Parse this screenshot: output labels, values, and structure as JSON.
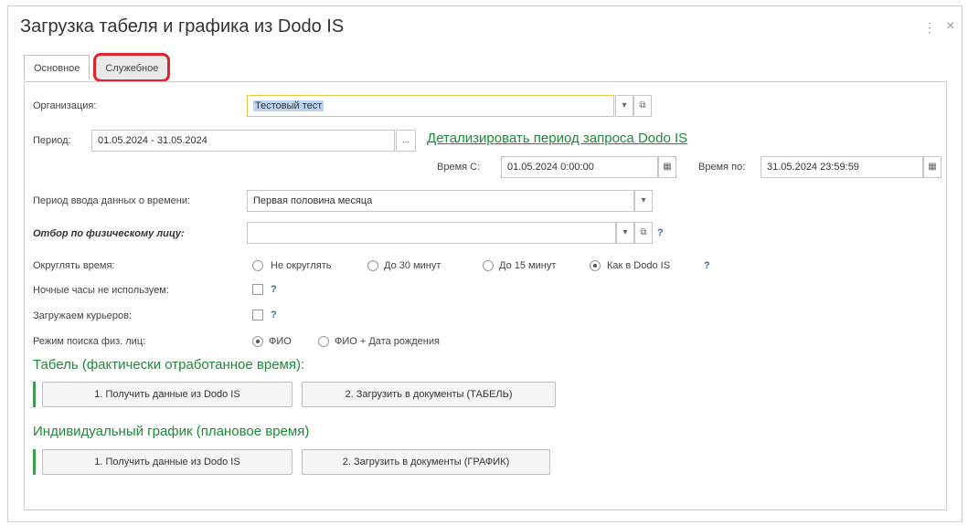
{
  "window": {
    "title": "Загрузка табеля и графика из Dodo IS",
    "menu_icon": "⋮",
    "close_icon": "×"
  },
  "tabs": [
    {
      "label": "Основное",
      "active": true
    },
    {
      "label": "Служебное",
      "highlighted": true
    }
  ],
  "form": {
    "org_label": "Организация:",
    "org_value": "Тестовый тест",
    "period_label": "Период:",
    "period_value": "01.05.2024 - 31.05.2024",
    "period_button": "...",
    "detail_link": "Детализировать период запроса Dodo IS",
    "time_from_label": "Время С:",
    "time_from_value": "01.05.2024  0:00:00",
    "time_to_label": "Время по:",
    "time_to_value": "31.05.2024 23:59:59",
    "input_period_label": "Период ввода данных о времени:",
    "input_period_value": "Первая половина  месяца",
    "filter_label": "Отбор по физическому лицу:",
    "filter_value": "",
    "round_label": "Округлять время:",
    "round_options": [
      "Не округлять",
      "До 30 минут",
      "До 15 минут",
      "Как в Dodo IS"
    ],
    "round_selected": 3,
    "night_label": "Ночные часы не используем:",
    "couriers_label": "Загружаем курьеров:",
    "search_label": "Режим поиска физ. лиц:",
    "search_options": [
      "ФИО",
      "ФИО + Дата рождения"
    ],
    "search_selected": 0,
    "help": "?"
  },
  "tabel": {
    "title": "Табель (фактически отработанное время):",
    "btn1": "1. Получить данные из Dodo IS",
    "btn2": "2. Загрузить в документы (ТАБЕЛЬ)"
  },
  "schedule": {
    "title": "Индивидуальный график (плановое время)",
    "btn1": "1. Получить данные из Dodo IS",
    "btn2": "2. Загрузить в документы (ГРАФИК)"
  },
  "icons": {
    "dropdown": "▾",
    "open": "⧉",
    "calendar": "▦"
  }
}
